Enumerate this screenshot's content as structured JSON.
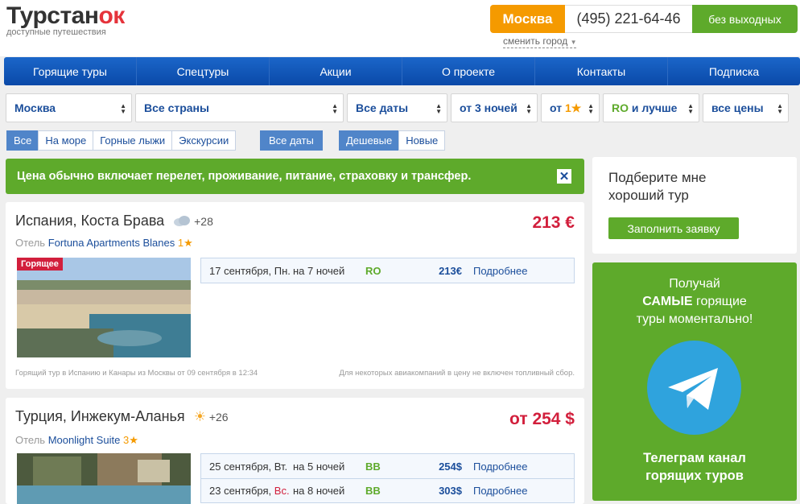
{
  "header": {
    "logo_main": "Турстан",
    "logo_accent": "ок",
    "logo_sub": "доступные путешествия",
    "city": "Москва",
    "phone": "(495) 221-64-46",
    "hours": "без выходных",
    "change_city": "сменить город"
  },
  "nav": [
    "Горящие туры",
    "Спецтуры",
    "Акции",
    "О проекте",
    "Контакты",
    "Подписка"
  ],
  "filters": {
    "city": "Москва",
    "country": "Все страны",
    "dates": "Все даты",
    "nights": "от 3 ночей",
    "stars_prefix": "от",
    "stars_value": "1",
    "board_code": "RO",
    "board_suffix": "и лучше",
    "price": "все цены"
  },
  "tabs": {
    "type": [
      "Все",
      "На море",
      "Горные лыжи",
      "Экскурсии"
    ],
    "dates": [
      "Все даты"
    ],
    "sort": [
      "Дешевые",
      "Новые"
    ]
  },
  "banner": {
    "text": "Цена обычно включает перелет, проживание, питание, страховку и трансфер.",
    "close": "✕"
  },
  "tours": [
    {
      "title": "Испания, Коста Брава",
      "weather_icon": "cloud-icon",
      "temp": "+28",
      "price": "213 €",
      "hotel_prefix": "Отель",
      "hotel": "Fortuna Apartments Blanes",
      "stars": "1",
      "badge": "Горящее",
      "offers": [
        {
          "date": "17 сентября,",
          "day": "Пн.",
          "day_red": false,
          "nights": "на 7 ночей",
          "board": "RO",
          "price": "213€",
          "more": "Подробнее"
        }
      ],
      "foot_left": "Горящий тур в Испанию и Канары из Москвы от 09 сентября в 12:34",
      "foot_right": "Для некоторых авиакомпаний в цену не включен топливный сбор."
    },
    {
      "title": "Турция, Инжекум-Аланья",
      "weather_icon": "sun-icon",
      "temp": "+26",
      "price": "от 254 $",
      "hotel_prefix": "Отель",
      "hotel": "Moonlight Suite",
      "stars": "3",
      "offers": [
        {
          "date": "25 сентября,",
          "day": "Вт.",
          "day_red": false,
          "nights": "на 5 ночей",
          "board": "BB",
          "price": "254$",
          "more": "Подробнее"
        },
        {
          "date": "23 сентября,",
          "day": "Вс.",
          "day_red": true,
          "nights": "на 8 ночей",
          "board": "BB",
          "price": "303$",
          "more": "Подробнее"
        }
      ]
    }
  ],
  "sidebar": {
    "request_text_1": "Подберите мне",
    "request_text_2": "хороший тур",
    "request_button": "Заполнить заявку",
    "tg_line1": "Получай",
    "tg_line2_bold": "САМЫЕ",
    "tg_line2_rest": "горящие",
    "tg_line3": "туры моментально!",
    "tg_bottom1": "Телеграм канал",
    "tg_bottom2": "горящих туров"
  },
  "colors": {
    "brand_blue": "#0a49a8",
    "accent_green": "#5eaa2b",
    "accent_orange": "#f59a00",
    "price_red": "#d21f3c",
    "telegram_blue": "#2fa3dd"
  }
}
